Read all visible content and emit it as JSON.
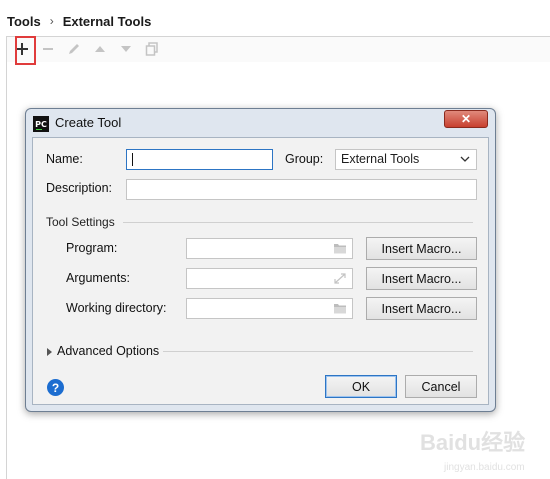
{
  "breadcrumb": {
    "root": "Tools",
    "separator": "›",
    "current": "External Tools"
  },
  "toolbar": {
    "icons": [
      "add-icon",
      "remove-icon",
      "edit-icon",
      "move-up-icon",
      "move-down-icon",
      "copy-icon"
    ]
  },
  "dialog": {
    "app_icon": "PC",
    "title": "Create Tool",
    "close_glyph": "✕",
    "name_label": "Name:",
    "name_value": "",
    "group_label": "Group:",
    "group_value": "External Tools",
    "description_label": "Description:",
    "description_value": "",
    "tool_settings_label": "Tool Settings",
    "program_label": "Program:",
    "arguments_label": "Arguments:",
    "working_dir_label": "Working directory:",
    "insert_macro_label": "Insert Macro...",
    "advanced_options_label": "Advanced Options",
    "help_glyph": "?",
    "ok_label": "OK",
    "cancel_label": "Cancel"
  },
  "watermark": {
    "text": "Baidu经验",
    "subtext": "jingyan.baidu.com"
  },
  "colors": {
    "highlight": "#e03b3b",
    "focus": "#2d75c4",
    "help": "#1c6dd0",
    "close": "#c8402f"
  }
}
